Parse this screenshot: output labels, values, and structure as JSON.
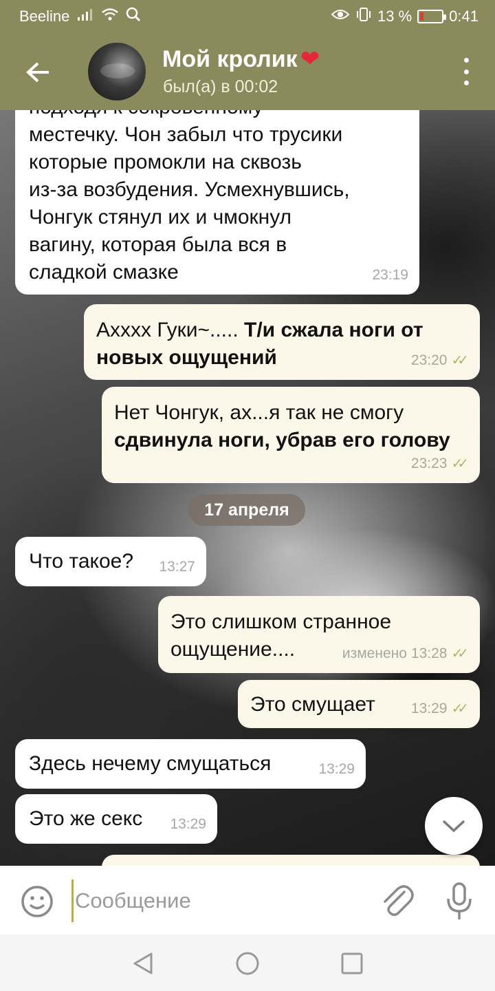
{
  "status_bar": {
    "carrier": "Beeline",
    "battery_percent": "13 %",
    "battery_level": 0.13,
    "time": "0:41"
  },
  "header": {
    "title": "Мой кролик",
    "title_emoji": "❤",
    "status": "был(а) в 00:02"
  },
  "messages": [
    {
      "direction": "in",
      "lines": [
        "подходя к сокровенному",
        "местечку. Чон забыл что трусики",
        "которые промокли на сквозь",
        "из-за возбудения. Усмехнувшись,",
        "Чонгук стянул их и чмокнул",
        "вагину, которая была вся в",
        "сладкой смазке"
      ],
      "time": "23:19"
    },
    {
      "direction": "out",
      "text_plain": "Ахххх Гуки~..... ",
      "text_bold_1": "Т/и сжала ноги от",
      "text_bold_2": "новых ощущений",
      "time": "23:20"
    },
    {
      "direction": "out",
      "text_plain": "Нет Чонгук, ах...я так не смогу",
      "text_bold": "сдвинула ноги, убрав его голову",
      "time": "23:23"
    },
    {
      "direction": "in",
      "text": "Что такое?",
      "time": "13:27"
    },
    {
      "direction": "out",
      "line1": "Это слишком странное",
      "line2": "ощущение....",
      "edited": "изменено",
      "time": "13:28"
    },
    {
      "direction": "out",
      "text": "Это смущает",
      "time": "13:29"
    },
    {
      "direction": "in",
      "text": "Здесь нечему смущаться",
      "time": "13:29"
    },
    {
      "direction": "in",
      "text": "Это же секс",
      "time": "13:29"
    }
  ],
  "date_separator": "17 апреля",
  "composer": {
    "placeholder": "Сообщение"
  },
  "icons": {
    "back": "arrow-left-icon",
    "menu": "more-vertical-icon",
    "emoji": "emoji-icon",
    "attach": "paperclip-icon",
    "mic": "microphone-icon",
    "scroll_down": "chevron-down-icon"
  },
  "colors": {
    "header_bg": "#8a8a5c",
    "outgoing_bubble": "#fbf8ea",
    "incoming_bubble": "#ffffff",
    "tick_color": "#b7b26a"
  }
}
